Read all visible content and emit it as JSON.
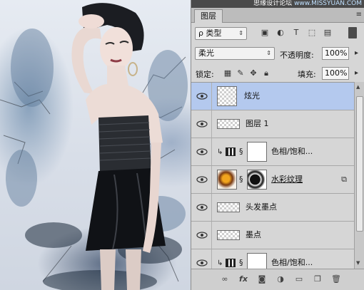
{
  "panel": {
    "watermark_cn": "思缘设计论坛",
    "watermark_en": "www.MISSYUAN.COM",
    "tab_title": "图层",
    "filter_kind": "ρ 类型",
    "blend_mode": "柔光",
    "opacity_label": "不透明度:",
    "opacity_value": "100%",
    "lock_label": "锁定:",
    "fill_label": "填充:",
    "fill_value": "100%"
  },
  "layers": [
    {
      "name": "炫光",
      "selected": true
    },
    {
      "name": "图层 1",
      "selected": false
    },
    {
      "name": "色相/饱和...",
      "selected": false
    },
    {
      "name": "水彩纹理",
      "selected": false
    },
    {
      "name": "头发墨点",
      "selected": false
    },
    {
      "name": "墨点",
      "selected": false
    },
    {
      "name": "色相/饱和...",
      "selected": false
    }
  ],
  "bottom_icons": [
    "link-icon",
    "fx-icon",
    "mask-icon",
    "adjustment-icon",
    "group-folder-icon",
    "new-layer-icon",
    "trash-icon"
  ],
  "colors": {
    "selection": "#b4c9ee",
    "panel_bg": "#d6d6d6"
  }
}
